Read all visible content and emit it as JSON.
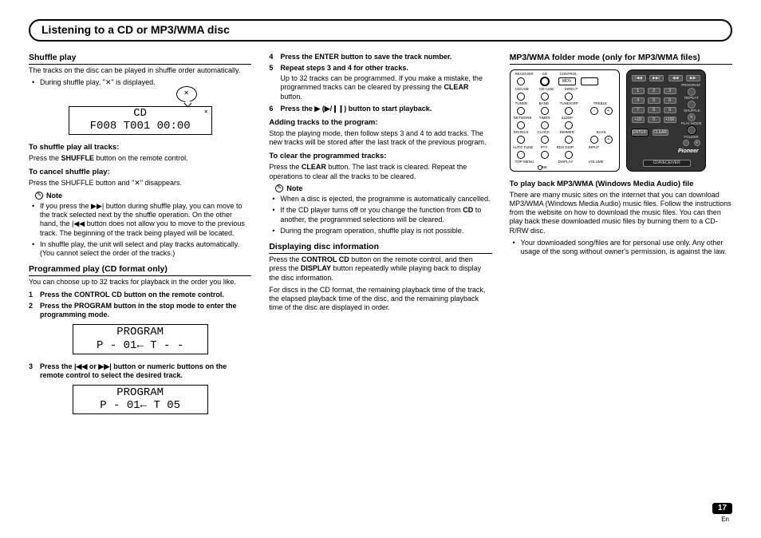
{
  "title_bar": "Listening to a CD or MP3/WMA disc",
  "col1": {
    "shuffle": {
      "heading": "Shuffle play",
      "p1": "The tracks on the disc can be played in shuffle order automatically.",
      "li1_a": "During shuffle play, \"",
      "li1_b": "\" is displayed.",
      "lcd_line1": "CD",
      "lcd_line2": "F008   T001     00:00",
      "bubble_icon": "✕",
      "sh_side": "✕",
      "h_all": "To shuffle play all tracks:",
      "p_all": "Press the SHUFFLE button on the remote control.",
      "h_cancel": "To cancel shuffle play:",
      "p_cancel_a": "Press the SHUFFLE button and \"",
      "p_cancel_b": "\" disappears.",
      "note": "Note",
      "n1": "If you press the ▶▶| button during shuffle play, you can move to the track selected next by the shuffle operation. On the other hand, the |◀◀ button does not allow you to move to the previous track. The beginning of the track being played will be located.",
      "n2": "In shuffle play, the unit will select and play tracks automatically. (You cannot select the order of the tracks.)"
    },
    "prog": {
      "heading": "Programmed play (CD format only)",
      "p1": "You can choose up to 32 tracks for playback in the order you like.",
      "s1": "Press the CONTROL CD button on the remote control.",
      "s2": "Press the PROGRAM button in the stop mode to enter the programming mode.",
      "lcd1_a": "PROGRAM",
      "lcd1_b": "P - 01← T -  -",
      "s3_a": "Press the ",
      "s3_b": " or ",
      "s3_c": " button or numeric buttons on the remote control to select the desired track.",
      "lcd2_a": "PROGRAM",
      "lcd2_b": "P - 01← T 05"
    }
  },
  "col2": {
    "s4": "Press the ENTER button to save the track number.",
    "s5": "Repeat steps 3 and 4 for other tracks.",
    "p5_a": "Up to 32 tracks can be programmed. If you make a mistake, the programmed tracks can be cleared by pressing the ",
    "p5_b": "CLEAR",
    "p5_c": " button.",
    "s6_a": "Press the ",
    "s6_b": " (▶/❙❙) button to start playback.",
    "add_h": "Adding tracks to the program:",
    "add_p": "Stop the playing mode, then follow steps 3 and 4 to add tracks. The new tracks will be stored after the last track of the previous program.",
    "clr_h": "To clear the programmed tracks:",
    "clr_p_a": "Press the ",
    "clr_p_b": "CLEAR",
    "clr_p_c": " button. The last track is cleared. Repeat the operations to clear all the tracks to be cleared.",
    "note": "Note",
    "n1": "When a disc is ejected, the programme is automatically cancelled.",
    "n2_a": "If the CD player turns off or you change the function from ",
    "n2_b": "CD",
    "n2_c": " to another, the programmed selections will be cleared.",
    "n3": "During the program operation, shuffle play is not possible.",
    "disp_h": "Displaying disc information",
    "disp_p1_a": "Press the ",
    "disp_p1_b": "CONTROL CD",
    "disp_p1_c": " button on the remote control, and then press the ",
    "disp_p1_d": "DISPLAY",
    "disp_p1_e": " button repeatedly while playing back to display the disc information.",
    "disp_p2": "For discs in the CD format, the remaining playback time of the track, the elapsed playback time of the disc, and the remaining playback time of the disc are displayed in order."
  },
  "col3": {
    "heading": "MP3/WMA folder mode (only for MP3/WMA files)",
    "remote1": {
      "row1": [
        "RECEIVER",
        "CD",
        "CONTROL"
      ],
      "mov": "MOV",
      "row2": [
        "CD/USB",
        "CD+USB",
        "DIRECT"
      ],
      "row3": [
        "TUNER",
        "BAND",
        "TUNE/GRP"
      ],
      "treble": "TREBLE",
      "row4": [
        "NETWORK",
        "TIMER",
        "SLEEP"
      ],
      "row5": [
        "DIGIN1/2",
        "CLOCK",
        "DIMMER"
      ],
      "bass": "BASS",
      "row6": [
        "AUTO TUNE",
        "PTY",
        "RDS DISP",
        "INPUT"
      ],
      "row7": [
        "TOP MENU",
        "",
        "DISPLAY",
        "VOLUME"
      ],
      "tune": "TUNE"
    },
    "remote2": {
      "row1_icons": [
        "|◀◀",
        "▶▶|",
        "◀◀",
        "▶▶"
      ],
      "nums": [
        "1",
        "2",
        "3",
        "4",
        "5",
        "6",
        "7",
        "8",
        "9",
        "+10",
        "0",
        "+100"
      ],
      "program": "PROGRAM",
      "repeat": "REPEAT",
      "shuffle": "SHUFFLE",
      "playmode": "PLAY MODE",
      "folder": "FOLDER",
      "enter": "ENTER",
      "clear": "CLEAR",
      "brand": "Pioneer",
      "label": "CD/RECEIVER"
    },
    "h_play": "To play back MP3/WMA (Windows Media Audio) file",
    "p1": "There are many music sites on the internet that you can download MP3/WMA (Windows Media Audio) music files. Follow the instructions from the website on how to download the music files. You can then play back these downloaded music files by burning them to a CD-R/RW disc.",
    "li1": "Your downloaded song/files are for personal use only. Any other usage of the song without owner's permission, is against the law."
  },
  "page": {
    "num": "17",
    "lang": "En"
  },
  "icons": {
    "shuffle": "✕",
    "prev": "|◀◀",
    "next": "▶▶|",
    "play": "▶"
  }
}
